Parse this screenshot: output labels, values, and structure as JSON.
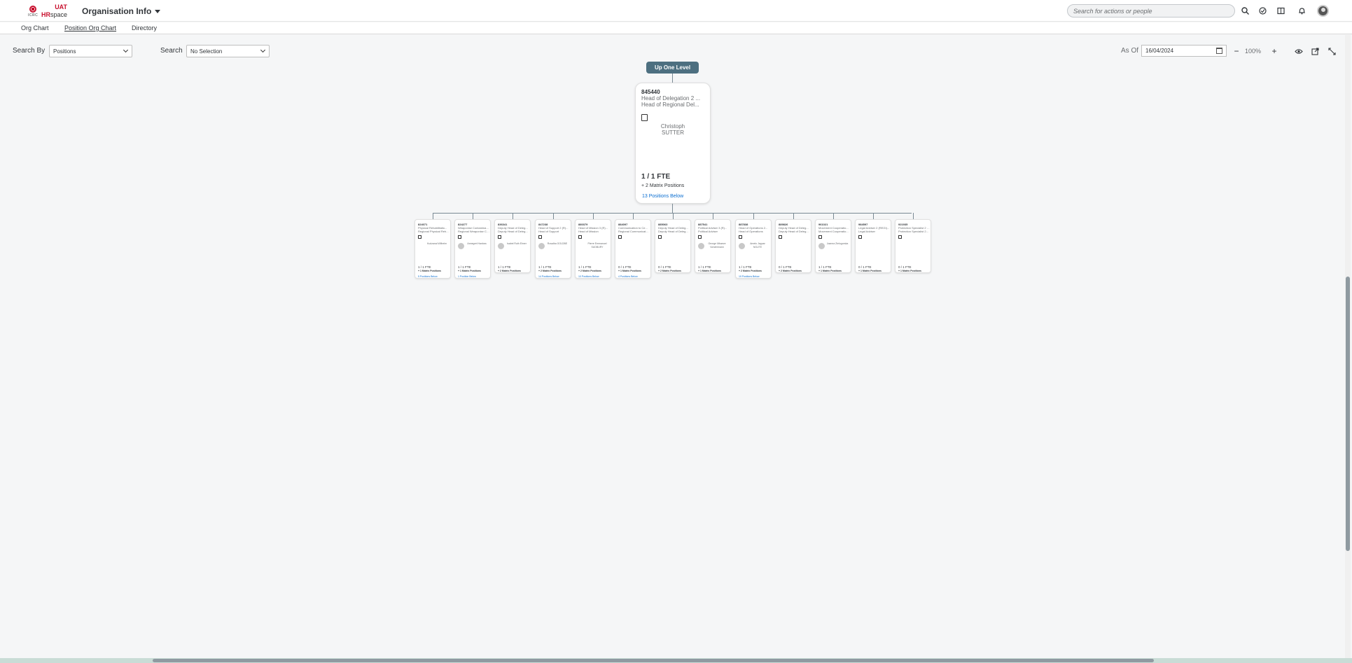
{
  "shell": {
    "logo": {
      "org": "ICRC",
      "hr": "HR",
      "space": "space",
      "badge": "UAT"
    },
    "app_title": "Organisation Info",
    "search_placeholder": "Search for actions or people",
    "icons": [
      "search-icon",
      "todo-icon",
      "notes-icon",
      "bell-icon"
    ]
  },
  "tabs": [
    "Org Chart",
    "Position Org Chart",
    "Directory"
  ],
  "active_tab": "Position Org Chart",
  "toolbar": {
    "search_by_label": "Search By",
    "search_by_value": "Positions",
    "search_label": "Search",
    "search_value": "No Selection",
    "as_of_label": "As Of",
    "date": "16/04/2024",
    "zoom": "100%"
  },
  "chart": {
    "up_one_level": "Up One Level",
    "root": {
      "id": "845440",
      "title1": "Head of Delegation 2 ...",
      "title2": "Head of Regional Del...",
      "person_first": "Christoph",
      "person_last": "SUTTER",
      "fte": "1 / 1 FTE",
      "matrix": "+ 2 Matrix Positions",
      "below": "13 Positions Below"
    },
    "children": [
      {
        "id": "824071",
        "t1": "Physical Rehabilitatio...",
        "t2": "Regional Physical Reh...",
        "person": "Kudzanai Wilhelm",
        "avatar": false,
        "fte": "1 / 1 FTE",
        "mx": "+ 1 Matrix Positions",
        "below": "5 Positions Below"
      },
      {
        "id": "824277",
        "t1": "Weaponise Contaminatio...",
        "t2": "Regional Weaponise Co...",
        "person": "Annegret Hankea",
        "avatar": true,
        "fte": "1 / 1 FTE",
        "mx": "+ 1 Matrix Positions",
        "below": "1 Position Below"
      },
      {
        "id": "836341",
        "t1": "Deputy Head of Deleg...",
        "t2": "Deputy Head of Deleg...",
        "person": "Isabel Ruth Elmer",
        "avatar": true,
        "fte": "1 / 1 FTE",
        "mx": "+ 2 Matrix Positions",
        "below": ""
      },
      {
        "id": "847238",
        "t1": "Head of Support 2 (R)...",
        "t2": "Head of Support",
        "person": "Rosalba GOLDBE",
        "avatar": true,
        "fte": "1 / 1 FTE",
        "mx": "+ 2 Matrix Positions",
        "below": "14 Positions Below"
      },
      {
        "id": "880379",
        "t1": "Head of Mission 3 (R)...",
        "t2": "Head of Mission",
        "person": "Pierre Emmanuel SUDBURY",
        "avatar": false,
        "fte": "1 / 1 FTE",
        "mx": "+ 2 Matrix Positions",
        "below": "10 Positions Below"
      },
      {
        "id": "884097",
        "t1": "Communication to Ce...",
        "t2": "Regional Communicat...",
        "person": "",
        "avatar": false,
        "fte": "0 / 1 FTE",
        "mx": "+ 1 Matrix Positions",
        "below": "4 Positions Below"
      },
      {
        "id": "885063",
        "t1": "Deputy Head of Deleg...",
        "t2": "Deputy Head of Deleg...",
        "person": "",
        "avatar": false,
        "fte": "0 / 1 FTE",
        "mx": "+ 2 Matrix Positions",
        "below": ""
      },
      {
        "id": "887541",
        "t1": "Political Adviser 3 (R)...",
        "t2": "Political Adviser",
        "person": "George Mbaeze Vorstermann",
        "avatar": true,
        "fte": "1 / 1 FTE",
        "mx": "+ 1 Matrix Positions",
        "below": ""
      },
      {
        "id": "887838",
        "t1": "Head of Operations 2...",
        "t2": "Head of Operations",
        "person": "Amelo Jaguar NGUTE",
        "avatar": true,
        "fte": "1 / 1 FTE",
        "mx": "+ 2 Matrix Positions",
        "below": "19 Positions Below"
      },
      {
        "id": "889826",
        "t1": "Deputy Head of Deleg...",
        "t2": "Deputy Head of Deleg...",
        "person": "",
        "avatar": false,
        "fte": "0 / 1 FTE",
        "mx": "+ 2 Matrix Positions",
        "below": ""
      },
      {
        "id": "961021",
        "t1": "Movement Cooperatio...",
        "t2": "Movement Cooperatio...",
        "person": "Joanna Zielogorska",
        "avatar": true,
        "fte": "1 / 1 FTE",
        "mx": "+ 1 Matrix Positions",
        "below": ""
      },
      {
        "id": "984597",
        "t1": "Legal Adviser 2 (REGI)...",
        "t2": "Legal Adviser",
        "person": "",
        "avatar": false,
        "fte": "0 / 1 FTE",
        "mx": "+ 1 Matrix Positions",
        "below": ""
      },
      {
        "id": "921935",
        "t1": "Protection Specialist 2 (...",
        "t2": "Protection Specialist 2...",
        "person": "",
        "avatar": false,
        "fte": "0 / 1 FTE",
        "mx": "+ 1 Matrix Positions",
        "below": ""
      }
    ]
  }
}
